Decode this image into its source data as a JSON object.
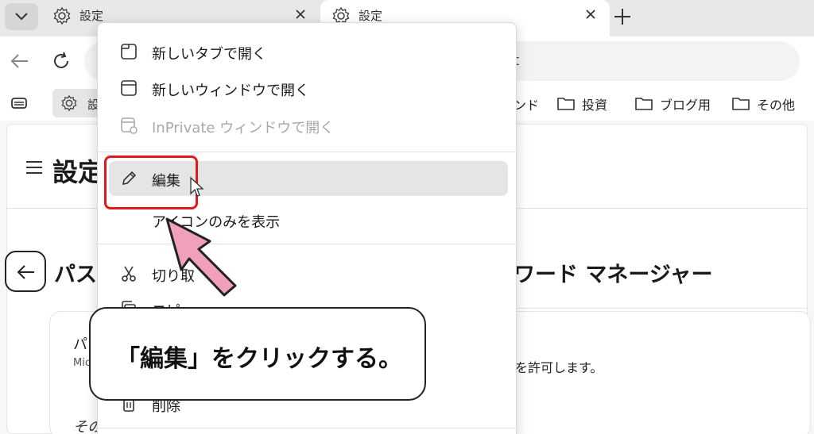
{
  "browser": {
    "tabs": [
      {
        "title": "設定",
        "active": false
      },
      {
        "title": "設定",
        "active": true
      }
    ],
    "address_partial": "t"
  },
  "favorites_bar": {
    "settings_label": "設",
    "partial_label": "ンド",
    "folders": [
      {
        "label": "投資",
        "icon": "folder-icon"
      },
      {
        "label": "ブログ用",
        "icon": "folder-icon"
      },
      {
        "label": "その他",
        "icon": "folder-icon"
      }
    ]
  },
  "page": {
    "title": "設定",
    "section_title_left": "パス",
    "section_title_right": "ワード マネージャー",
    "card_heading": "パ",
    "card_sub": "Mic",
    "card_right_text": "を許可します。",
    "card_lower_text": "その"
  },
  "context_menu": {
    "items": [
      {
        "label": "新しいタブで開く",
        "icon": "tab-icon",
        "disabled": false
      },
      {
        "label": "新しいウィンドウで開く",
        "icon": "window-icon",
        "disabled": false
      },
      {
        "label": "InPrivate ウィンドウで開く",
        "icon": "inprivate-window-icon",
        "disabled": true
      },
      {
        "label": "編集",
        "icon": "pencil-icon",
        "disabled": false,
        "highlighted": true
      },
      {
        "label": "アイコンのみを表示",
        "icon": "",
        "disabled": false
      },
      {
        "label": "切り取",
        "icon": "scissors-icon",
        "disabled": false
      },
      {
        "label": "コピ",
        "icon": "copy-icon",
        "disabled": false
      },
      {
        "label": "削除",
        "icon": "trash-icon",
        "disabled": false
      }
    ]
  },
  "annotation": {
    "callout_text": "「編集」をクリックする。",
    "highlight_color": "#e0191b",
    "arrow_color": "#f0a0b8"
  }
}
